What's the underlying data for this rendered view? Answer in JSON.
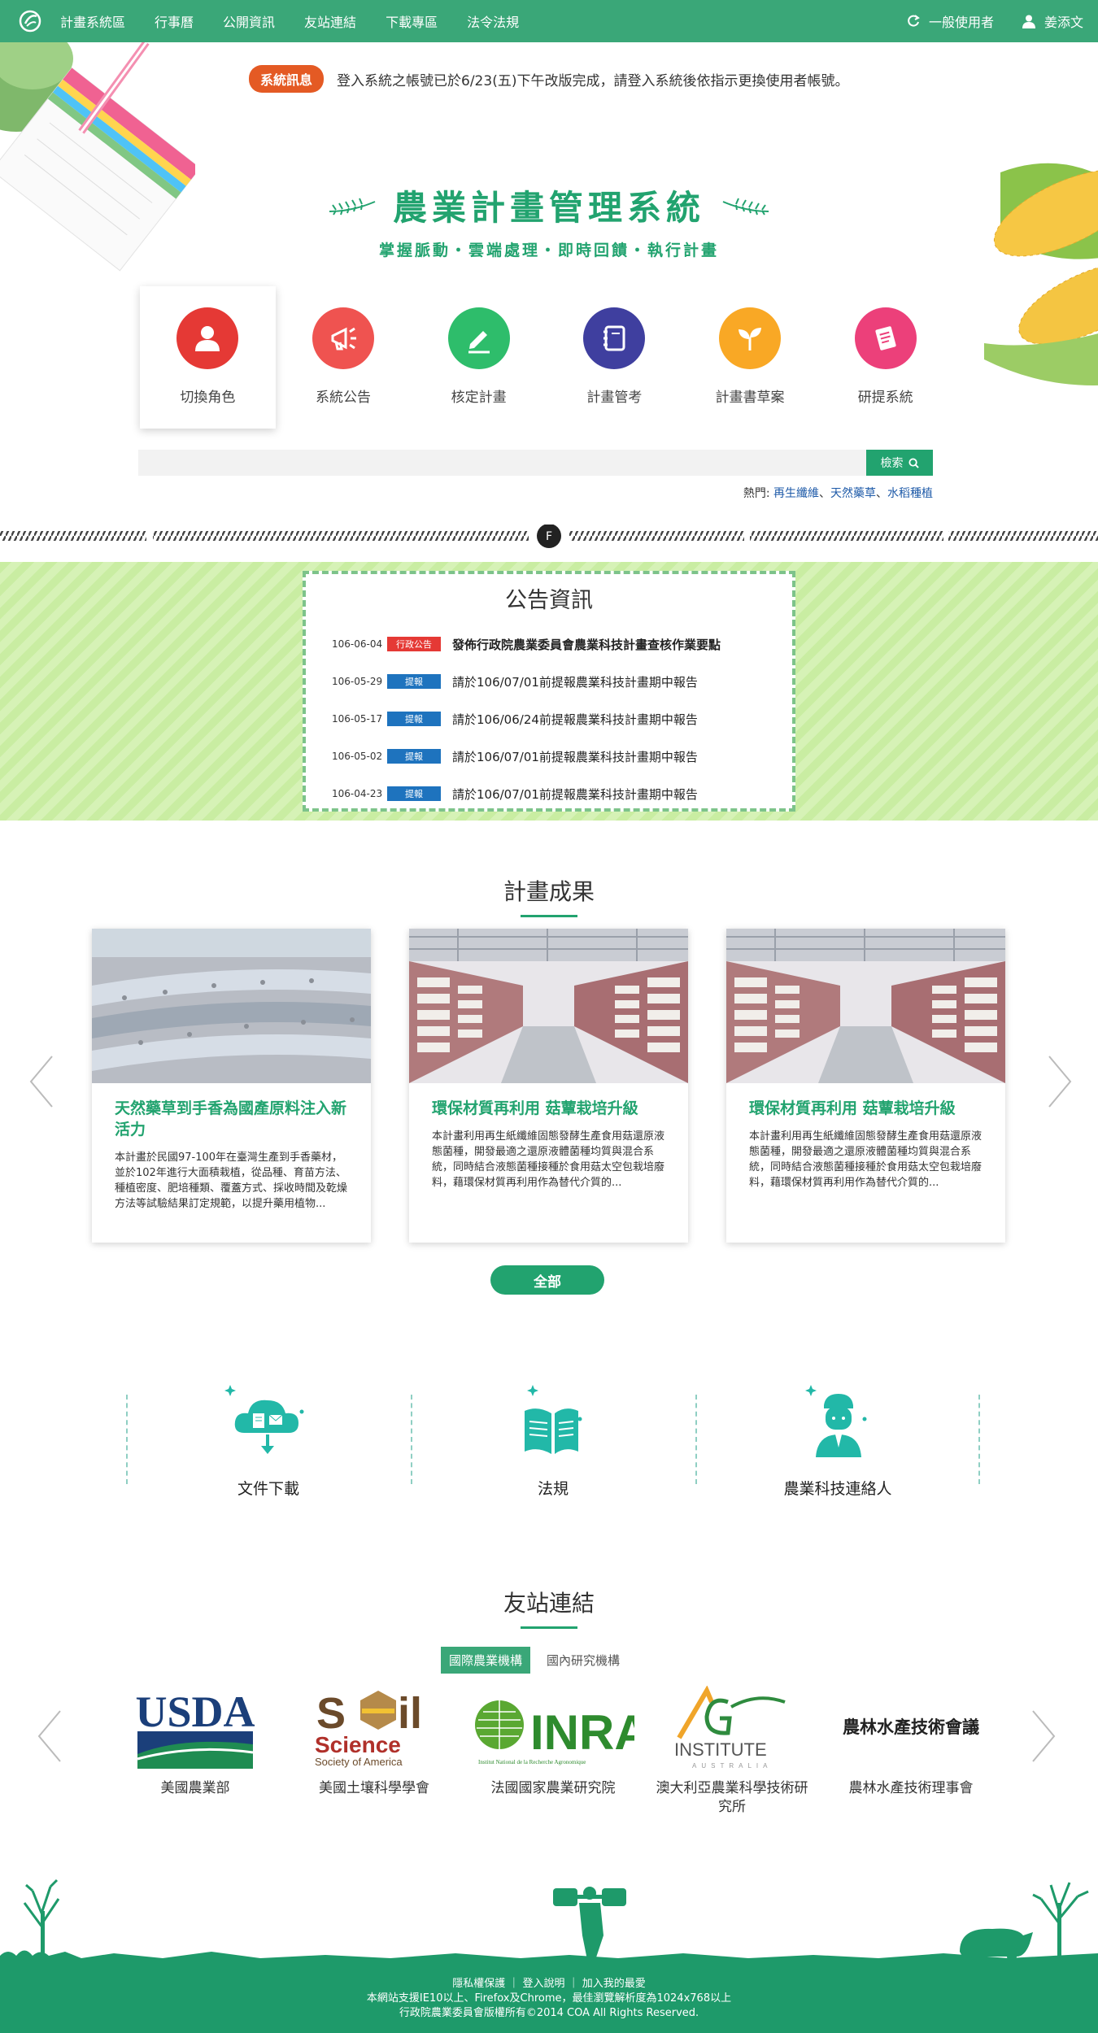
{
  "nav": {
    "items": [
      "計畫系統區",
      "行事曆",
      "公開資訊",
      "友站連結",
      "下載專區",
      "法令法規"
    ],
    "role_label": "一般使用者",
    "user_name": "姜添文"
  },
  "system_message": {
    "badge": "系統訊息",
    "text": "登入系統之帳號已於6/23(五)下午改版完成，請登入系統後依指示更換使用者帳號。"
  },
  "hero": {
    "title": "農業計畫管理系統",
    "subtitle": "掌握脈動‧雲端處理‧即時回饋‧執行計畫"
  },
  "features": [
    {
      "label": "切換角色",
      "color": "#e53935",
      "icon": "user-icon"
    },
    {
      "label": "系統公告",
      "color": "#ef5350",
      "icon": "megaphone-icon"
    },
    {
      "label": "核定計畫",
      "color": "#2ebd6b",
      "icon": "pencil-icon"
    },
    {
      "label": "計畫管考",
      "color": "#3f3f9f",
      "icon": "notebook-icon"
    },
    {
      "label": "計畫書草案",
      "color": "#f9a825",
      "icon": "sprout-icon"
    },
    {
      "label": "研提系統",
      "color": "#ec407a",
      "icon": "document-icon"
    }
  ],
  "search": {
    "placeholder": "",
    "button_label": "檢索",
    "hot_label": "熱門:",
    "hot_terms": [
      "再生纖維",
      "天然藥草",
      "水稻種植"
    ]
  },
  "divider_badge": "F",
  "news": {
    "title": "公告資訊",
    "items": [
      {
        "date": "106-06-04",
        "tag": "行政公告",
        "tag_color": "#e53935",
        "text": "發佈行政院農業委員會農業科技計畫查核作業要點",
        "bold": true
      },
      {
        "date": "106-05-29",
        "tag": "提報",
        "tag_color": "#1e73be",
        "text": "請於106/07/01前提報農業科技計畫期中報告",
        "bold": false
      },
      {
        "date": "106-05-17",
        "tag": "提報",
        "tag_color": "#1e73be",
        "text": "請於106/06/24前提報農業科技計畫期中報告",
        "bold": false
      },
      {
        "date": "106-05-02",
        "tag": "提報",
        "tag_color": "#1e73be",
        "text": "請於106/07/01前提報農業科技計畫期中報告",
        "bold": false
      },
      {
        "date": "106-04-23",
        "tag": "提報",
        "tag_color": "#1e73be",
        "text": "請於106/07/01前提報農業科技計畫期中報告",
        "bold": false
      }
    ]
  },
  "results": {
    "title": "計畫成果",
    "cards": [
      {
        "title": "天然藥草到手香為國產原料注入新活力",
        "desc": "本計畫於民國97-100年在臺灣生產到手香藥材，並於102年進行大面積栽植，從品種、育苗方法、種植密度、肥培種類、覆蓋方式、採收時間及乾燥方法等試驗結果訂定規範，以提升藥用植物...",
        "image": "field-photo"
      },
      {
        "title": "環保材質再利用 菇蕈栽培升級",
        "desc": "本計畫利用再生紙纖維固態發酵生產食用菇還原液態菌種，開發最適之還原液體菌種均質與混合系統，同時結合液態菌種接種於食用菇太空包栽培廢料，藉環保材質再利用作為替代介質的...",
        "image": "mushroom-photo"
      },
      {
        "title": "環保材質再利用 菇蕈栽培升級",
        "desc": "本計畫利用再生紙纖維固態發酵生產食用菇還原液態菌種，開發最適之還原液體菌種均質與混合系統，同時結合液態菌種接種於食用菇太空包栽培廢料，藉環保材質再利用作為替代介質的...",
        "image": "mushroom-photo"
      }
    ],
    "all_button": "全部"
  },
  "quick_links": [
    {
      "label": "文件下載",
      "icon": "cloud-download-icon"
    },
    {
      "label": "法規",
      "icon": "book-icon"
    },
    {
      "label": "農業科技連絡人",
      "icon": "person-icon"
    }
  ],
  "partners": {
    "title": "友站連結",
    "tabs": [
      "國際農業機構",
      "國內研究機構"
    ],
    "items": [
      {
        "name": "美國農業部",
        "logo_text": "USDA"
      },
      {
        "name": "美國土壤科學學會",
        "logo_text": "Soil Science Society of America"
      },
      {
        "name": "法國國家農業研究院",
        "logo_text": "INRA"
      },
      {
        "name": "澳大利亞農業科學技術研究所",
        "logo_text": "AG INSTITUTE AUSTRALIA"
      },
      {
        "name": "農林水產技術理事會",
        "logo_text": "農林水產技術會議"
      }
    ]
  },
  "footer": {
    "links": [
      "隱私權保護",
      "登入說明",
      "加入我的最愛"
    ],
    "line2": "本網站支援IE10以上、Firefox及Chrome，最佳瀏覽解析度為1024x768以上",
    "line3": "行政院農業委員會版權所有©2014 COA All Rights Reserved."
  },
  "colors": {
    "brand_green": "#3aa778",
    "accent_green": "#22a36f",
    "alert_orange": "#e45a24"
  }
}
